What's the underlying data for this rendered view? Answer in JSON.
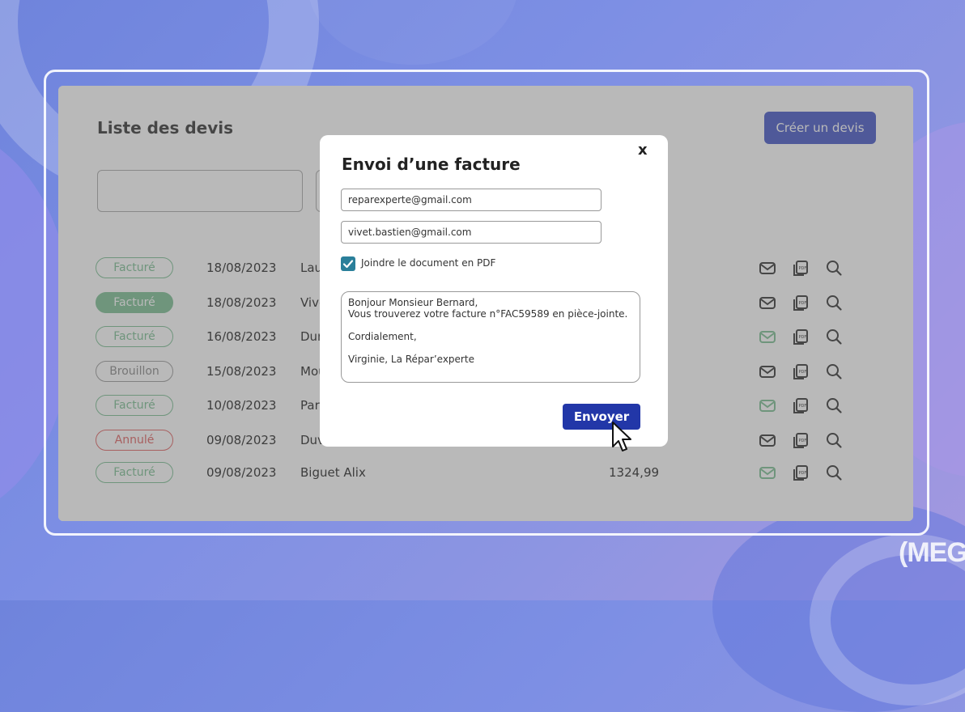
{
  "brand_logo": "(MEG",
  "page": {
    "title": "Liste des devis",
    "create_button": "Créer un devis"
  },
  "rows": [
    {
      "status": "Facturé",
      "status_style": "outline-green",
      "date": "18/08/2023",
      "client": "Lau",
      "amount": "",
      "mail_color": "#333333"
    },
    {
      "status": "Facturé",
      "status_style": "filled-green",
      "date": "18/08/2023",
      "client": "Vive",
      "amount": "",
      "mail_color": "#333333"
    },
    {
      "status": "Facturé",
      "status_style": "outline-green",
      "date": "16/08/2023",
      "client": "Dur",
      "amount": "",
      "mail_color": "#7bbf93"
    },
    {
      "status": "Brouillon",
      "status_style": "outline-grey",
      "date": "15/08/2023",
      "client": "Mou",
      "amount": "",
      "mail_color": "#333333"
    },
    {
      "status": "Facturé",
      "status_style": "outline-green",
      "date": "10/08/2023",
      "client": "Par",
      "amount": "",
      "mail_color": "#7bbf93"
    },
    {
      "status": "Annulé",
      "status_style": "outline-red",
      "date": "09/08/2023",
      "client": "Duv",
      "amount": "",
      "mail_color": "#333333"
    },
    {
      "status": "Facturé",
      "status_style": "outline-green",
      "date": "09/08/2023",
      "client": "Biguet Alix",
      "amount": "1324,99",
      "mail_color": "#7bbf93"
    }
  ],
  "modal": {
    "title": "Envoi d’une facture",
    "close": "x",
    "from_email": "reparexperte@gmail.com",
    "to_email": "vivet.bastien@gmail.com",
    "attach_pdf_checked": true,
    "attach_pdf_label": "Joindre le document en PDF",
    "message": "Bonjour Monsieur Bernard,\nVous trouverez votre facture n°FAC59589 en pièce-jointe.\n\nCordialement,\n\nVirginie, La Répar’experte",
    "send_button": "Envoyer"
  },
  "colors": {
    "primary": "#2237a8",
    "create_button": "#4254c6",
    "checkbox": "#2a7f9a",
    "status_green": "#7bbf93",
    "status_red": "#e06060",
    "status_grey": "#9a9a9a"
  }
}
